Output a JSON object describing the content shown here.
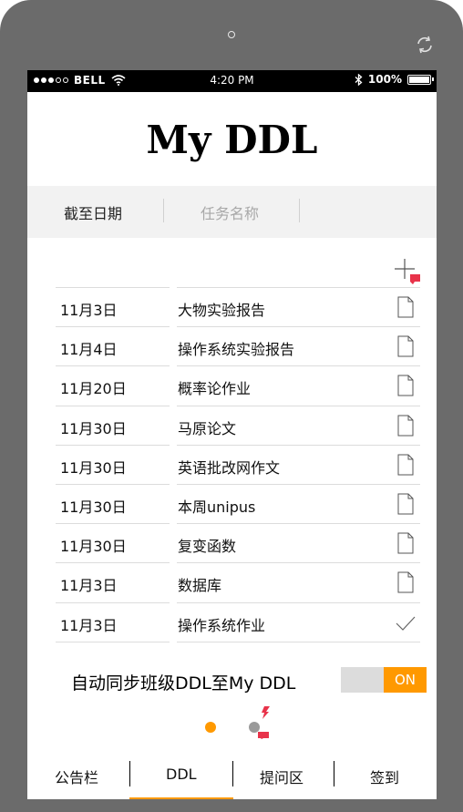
{
  "status_bar": {
    "carrier": "BELL",
    "time": "4:20 PM",
    "battery": "100%"
  },
  "app": {
    "title": "My DDL"
  },
  "tabs": {
    "date_label": "截至日期",
    "name_label": "任务名称"
  },
  "tasks": [
    {
      "date": "11月3日",
      "name": "大物实验报告",
      "status": "document-icon"
    },
    {
      "date": "11月4日",
      "name": "操作系统实验报告",
      "status": "document-icon"
    },
    {
      "date": "11月20日",
      "name": "概率论作业",
      "status": "document-icon"
    },
    {
      "date": "11月30日",
      "name": "马原论文",
      "status": "document-icon"
    },
    {
      "date": "11月30日",
      "name": "英语批改网作文",
      "status": "document-icon"
    },
    {
      "date": "11月30日",
      "name": "本周unipus",
      "status": "document-icon"
    },
    {
      "date": "11月30日",
      "name": "复变函数",
      "status": "document-icon"
    },
    {
      "date": "11月3日",
      "name": "数据库",
      "status": "document-icon"
    },
    {
      "date": "11月3日",
      "name": "操作系统作业",
      "status": "checkmark-icon"
    }
  ],
  "sync": {
    "label": "自动同步班级DDL至My DDL",
    "toggle_on_label": "ON"
  },
  "pager": {
    "pages": 2,
    "active_page": 1
  },
  "nav": {
    "items": [
      "公告栏",
      "DDL",
      "提问区",
      "签到"
    ],
    "active": "DDL"
  },
  "colors": {
    "accent": "#ff9900",
    "hotspot_marker": "#e8334a",
    "device_frame": "#6b6b6b",
    "tab_bar_bg": "#f2f2f2"
  }
}
